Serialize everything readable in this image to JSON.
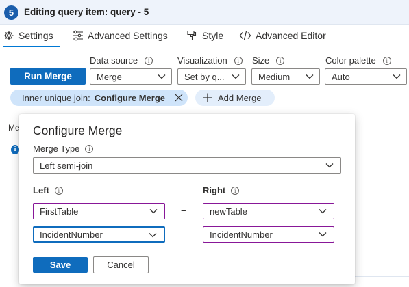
{
  "header": {
    "step": "5",
    "title": "Editing query item: query - 5"
  },
  "tabs": [
    {
      "label": "Settings",
      "icon": "gear-icon",
      "active": true
    },
    {
      "label": "Advanced Settings",
      "icon": "sliders-icon"
    },
    {
      "label": "Style",
      "icon": "brush-icon"
    },
    {
      "label": "Advanced Editor",
      "icon": "code-icon"
    }
  ],
  "toolbar": {
    "run_merge": "Run Merge",
    "data_source": {
      "label": "Data source",
      "value": "Merge"
    },
    "visualization": {
      "label": "Visualization",
      "value": "Set by q..."
    },
    "size": {
      "label": "Size",
      "value": "Medium"
    },
    "color_palette": {
      "label": "Color palette",
      "value": "Auto"
    }
  },
  "merge_pill": {
    "prefix": "Inner unique join:",
    "action": "Configure Merge"
  },
  "add_merge": "Add Merge",
  "background": {
    "partial_label": "Me"
  },
  "modal": {
    "title": "Configure Merge",
    "merge_type_label": "Merge Type",
    "merge_type_value": "Left semi-join",
    "left_label": "Left",
    "right_label": "Right",
    "equals": "=",
    "left_table": "FirstTable",
    "left_column": "IncidentNumber",
    "right_table": "newTable",
    "right_column": "IncidentNumber",
    "save": "Save",
    "cancel": "Cancel"
  },
  "colors": {
    "accent": "#0f6cbd",
    "pill_bg": "#cfe4fa",
    "header_bg": "#eef3fb",
    "focus_border": "#881798"
  }
}
